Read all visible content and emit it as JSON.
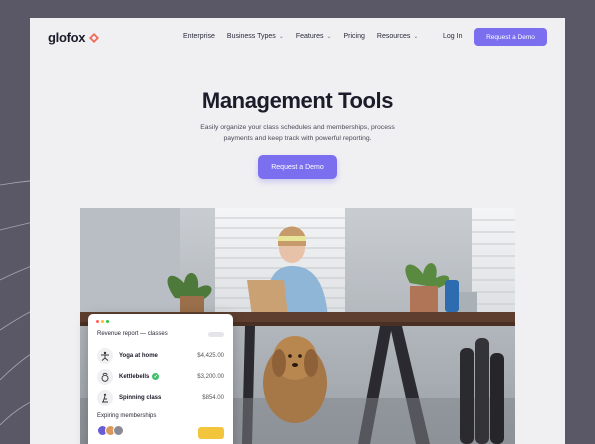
{
  "brand": {
    "name": "glofox",
    "accent": "#7b6ff0",
    "logo_color": "#ef6b57"
  },
  "nav": {
    "links": [
      {
        "label": "Enterprise",
        "dropdown": false
      },
      {
        "label": "Business Types",
        "dropdown": true
      },
      {
        "label": "Features",
        "dropdown": true
      },
      {
        "label": "Pricing",
        "dropdown": false
      },
      {
        "label": "Resources",
        "dropdown": true
      }
    ],
    "login": "Log In",
    "cta": "Request a Demo"
  },
  "hero": {
    "title": "Management Tools",
    "subtitle": "Easily organize your class schedules and memberships, process payments and keep track with powerful reporting.",
    "cta": "Request a Demo"
  },
  "report_card": {
    "title": "Revenue report — classes",
    "rows": [
      {
        "name": "Yoga at home",
        "amount": "$4,425.00",
        "icon": "yoga-icon",
        "badge": false
      },
      {
        "name": "Kettlebells",
        "amount": "$3,200.00",
        "icon": "kettlebell-icon",
        "badge": true
      },
      {
        "name": "Spinning class",
        "amount": "$854.00",
        "icon": "cycling-icon",
        "badge": false
      }
    ],
    "expiring_label": "Expiring memberships",
    "window_dot_colors": [
      "#ff5f57",
      "#febc2e",
      "#28c840"
    ]
  }
}
